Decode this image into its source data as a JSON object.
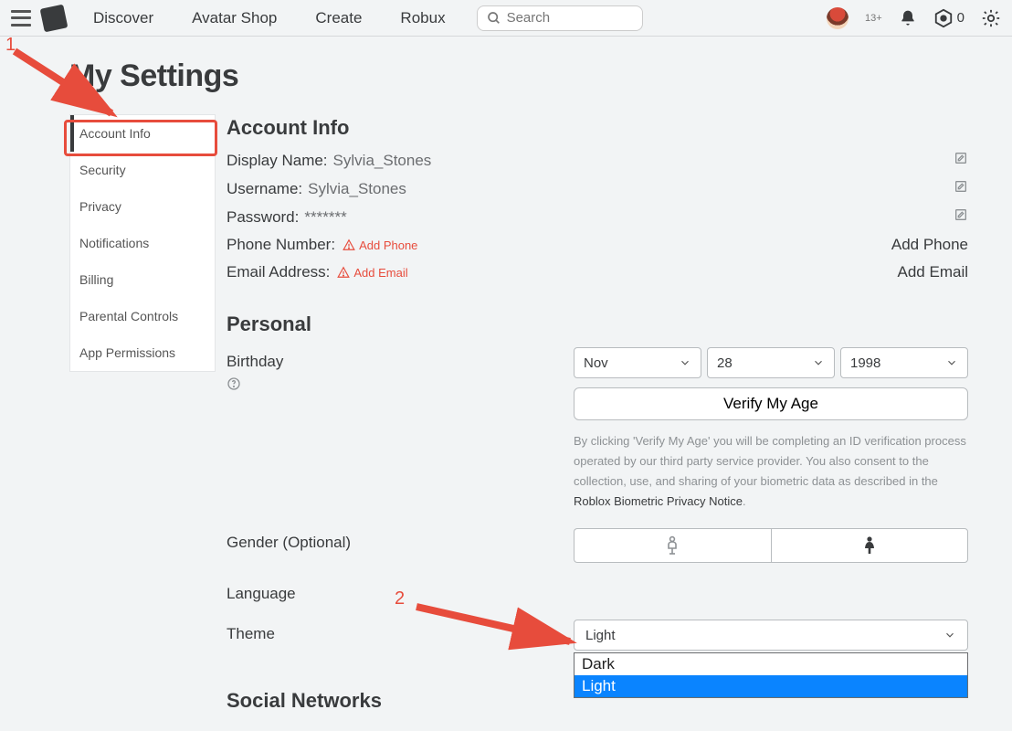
{
  "nav": {
    "links": [
      "Discover",
      "Avatar Shop",
      "Create",
      "Robux"
    ],
    "search_placeholder": "Search",
    "age_badge": "13+",
    "robux_count": "0"
  },
  "page_title": "My Settings",
  "sidebar": {
    "items": [
      {
        "label": "Account Info",
        "active": true
      },
      {
        "label": "Security"
      },
      {
        "label": "Privacy"
      },
      {
        "label": "Notifications"
      },
      {
        "label": "Billing"
      },
      {
        "label": "Parental Controls"
      },
      {
        "label": "App Permissions"
      }
    ]
  },
  "account_info": {
    "heading": "Account Info",
    "display_name_label": "Display Name:",
    "display_name_value": "Sylvia_Stones",
    "username_label": "Username:",
    "username_value": "Sylvia_Stones",
    "password_label": "Password:",
    "password_value": "*******",
    "phone_label": "Phone Number:",
    "phone_warn": "Add Phone",
    "phone_action": "Add Phone",
    "email_label": "Email Address:",
    "email_warn": "Add Email",
    "email_action": "Add Email"
  },
  "personal": {
    "heading": "Personal",
    "birthday_label": "Birthday",
    "birthday_month": "Nov",
    "birthday_day": "28",
    "birthday_year": "1998",
    "verify_button": "Verify My Age",
    "disclaimer_a": "By clicking 'Verify My Age' you will be completing an ID verification process operated by our third party service provider. You also consent to the collection, use, and sharing of your biometric data as described in the ",
    "disclaimer_link": "Roblox Biometric Privacy Notice",
    "disclaimer_b": ".",
    "gender_label": "Gender (Optional)",
    "language_label": "Language",
    "theme_label": "Theme",
    "theme_selected": "Light",
    "theme_options": [
      "Dark",
      "Light"
    ]
  },
  "social_heading": "Social Networks",
  "annotations": {
    "one": "1",
    "two": "2"
  }
}
